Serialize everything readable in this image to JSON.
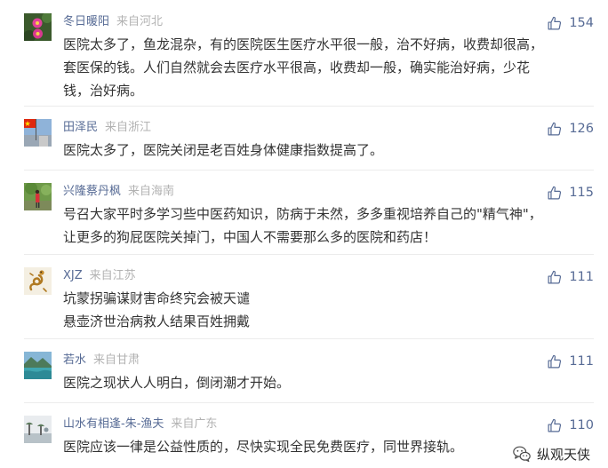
{
  "comments": [
    {
      "username": "冬日暖阳",
      "location": "来自河北",
      "likes": "154",
      "lines": [
        "医院太多了，鱼龙混杂，有的医院医生医疗水平很一般，治不好病，收费却很高，",
        "套医保的钱。人们自然就会去医疗水平很高，收费却一般，确实能治好病，少花",
        "钱，治好病。"
      ]
    },
    {
      "username": "田泽民",
      "location": "来自浙江",
      "likes": "126",
      "lines": [
        "医院太多了，医院关闭是老百姓身体健康指数提高了。"
      ]
    },
    {
      "username": "兴隆蔡丹枫",
      "location": "来自海南",
      "likes": "115",
      "lines": [
        "号召大家平时多学习些中医药知识，防病于未然，多多重视培养自己的\"精气神\"，",
        "让更多的狗屁医院关掉门，中国人不需要那么多的医院和药店！"
      ]
    },
    {
      "username": "XJZ",
      "location": "来自江苏",
      "likes": "111",
      "lines": [
        "坑蒙拐骗谋财害命终究会被天谴",
        "悬壶济世治病救人结果百姓拥戴"
      ]
    },
    {
      "username": "若水",
      "location": "来自甘肃",
      "likes": "111",
      "lines": [
        "医院之现状人人明白，倒闭潮才开始。"
      ]
    },
    {
      "username": "山水有相逢-朱-渔夫",
      "location": "来自广东",
      "likes": "110",
      "lines": [
        "医院应该一律是公益性质的，尽快实现全民免费医疗，同世界接轨。"
      ]
    }
  ],
  "watermark": {
    "text": "纵观天侠",
    "icon": "wechat-icon"
  },
  "colors": {
    "username": "#576b95",
    "location": "#b2b2b2",
    "body": "#333333",
    "divider": "#ececec"
  }
}
